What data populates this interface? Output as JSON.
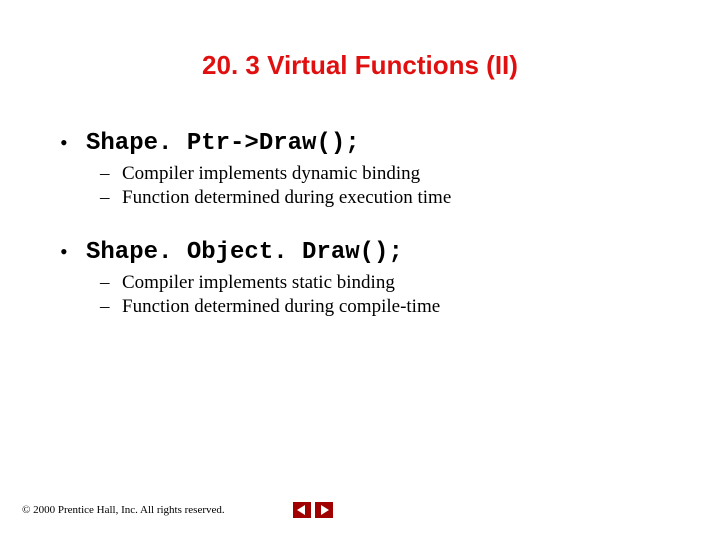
{
  "title": "20. 3 Virtual Functions (II)",
  "bullets": [
    {
      "text": "Shape. Ptr->Draw();",
      "sub": [
        "Compiler implements dynamic binding",
        "Function determined during execution time"
      ]
    },
    {
      "text": "Shape. Object. Draw();",
      "sub": [
        "Compiler implements static binding",
        "Function determined during compile-time"
      ]
    }
  ],
  "footer": {
    "copyright": "© 2000 Prentice Hall, Inc. All rights reserved."
  }
}
